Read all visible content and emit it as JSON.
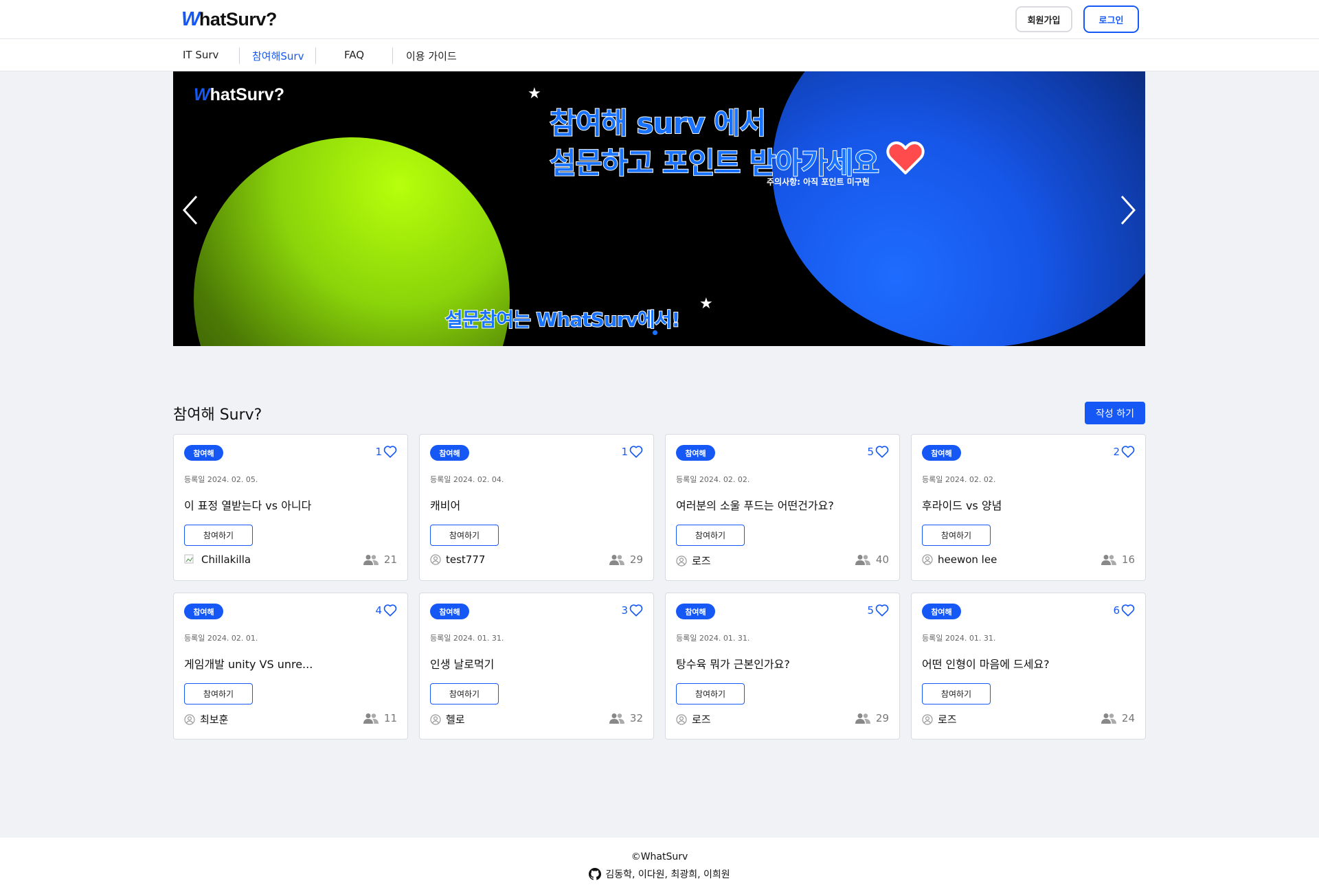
{
  "header": {
    "logo_w": "W",
    "logo_rest": "hatSurv?",
    "signup_label": "회원가입",
    "login_label": "로그인"
  },
  "nav": {
    "items": [
      {
        "label": "IT Surv"
      },
      {
        "label": "참여해Surv",
        "active": true
      },
      {
        "label": "FAQ"
      },
      {
        "label": "이용 가이드"
      }
    ]
  },
  "banner": {
    "logo_w": "W",
    "logo_rest": "hatSurv?",
    "headline_1": "참여해 surv 에서",
    "headline_2": "설문하고 포인트 받아가세요",
    "notice": "주의사항: 아직 포인트 미구현",
    "bottom_line": "설문참여는 WhatSurv에서!",
    "colors": {
      "green": "#b7ff0b",
      "blue": "#1656e8",
      "text_blue": "#1a73ff",
      "heart": "#ff4b4b"
    }
  },
  "section": {
    "title": "참여해 Surv?",
    "write_label": "작성 하기"
  },
  "cards": [
    {
      "badge": "참여해",
      "likes": "1",
      "date": "등록일 2024. 02. 05.",
      "title": "이 표정 열받는다 vs 아니다",
      "join_label": "참여하기",
      "author": "Chillakilla",
      "participants": "21",
      "avatar": "broken-image-icon"
    },
    {
      "badge": "참여해",
      "likes": "1",
      "date": "등록일 2024. 02. 04.",
      "title": "캐비어",
      "join_label": "참여하기",
      "author": "test777",
      "participants": "29",
      "avatar": "user-circle-icon"
    },
    {
      "badge": "참여해",
      "likes": "5",
      "date": "등록일 2024. 02. 02.",
      "title": "여러분의 소울 푸드는 어떤건가요?",
      "join_label": "참여하기",
      "author": "로즈",
      "participants": "40",
      "avatar": "user-circle-icon"
    },
    {
      "badge": "참여해",
      "likes": "2",
      "date": "등록일 2024. 02. 02.",
      "title": "후라이드 vs 양념",
      "join_label": "참여하기",
      "author": "heewon lee",
      "participants": "16",
      "avatar": "user-circle-icon"
    },
    {
      "badge": "참여해",
      "likes": "4",
      "date": "등록일 2024. 02. 01.",
      "title": "게임개발 unity VS unre...",
      "join_label": "참여하기",
      "author": "최보훈",
      "participants": "11",
      "avatar": "user-circle-icon"
    },
    {
      "badge": "참여해",
      "likes": "3",
      "date": "등록일 2024. 01. 31.",
      "title": "인생 날로먹기",
      "join_label": "참여하기",
      "author": "헬로",
      "participants": "32",
      "avatar": "user-circle-icon"
    },
    {
      "badge": "참여해",
      "likes": "5",
      "date": "등록일 2024. 01. 31.",
      "title": "탕수육 뭐가 근본인가요?",
      "join_label": "참여하기",
      "author": "로즈",
      "participants": "29",
      "avatar": "user-circle-icon"
    },
    {
      "badge": "참여해",
      "likes": "6",
      "date": "등록일 2024. 01. 31.",
      "title": "어떤 인형이 마음에 드세요?",
      "join_label": "참여하기",
      "author": "로즈",
      "participants": "24",
      "avatar": "user-circle-icon"
    }
  ],
  "footer": {
    "copyright": "©WhatSurv",
    "members": "김동학, 이다원, 최광희, 이희원"
  },
  "theme": {
    "accent": "#1558f5",
    "background": "#f1f2f5"
  }
}
